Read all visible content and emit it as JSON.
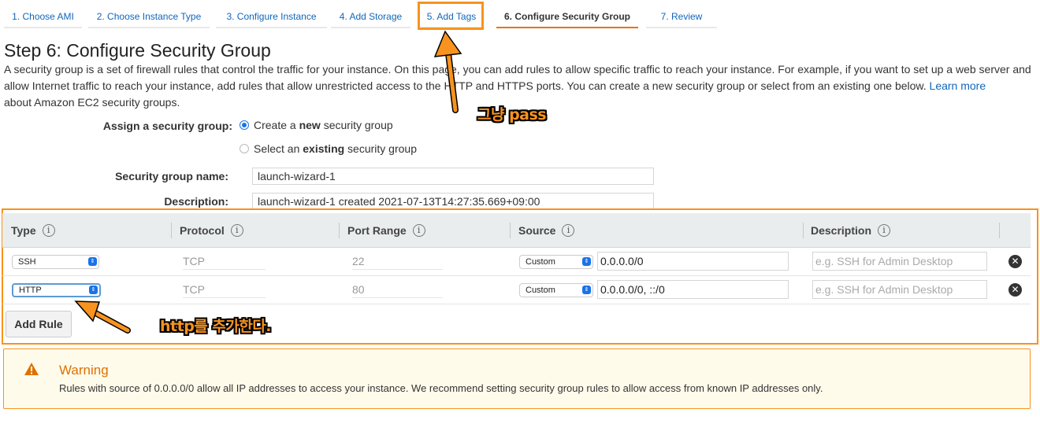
{
  "wizard": {
    "tabs": [
      {
        "label": "1. Choose AMI"
      },
      {
        "label": "2. Choose Instance Type"
      },
      {
        "label": "3. Configure Instance"
      },
      {
        "label": "4. Add Storage"
      },
      {
        "label": "5. Add Tags"
      },
      {
        "label": "6. Configure Security Group"
      },
      {
        "label": "7. Review"
      }
    ],
    "active_tab": "6. Configure Security Group"
  },
  "page": {
    "title": "Step 6: Configure Security Group",
    "intro_text": "A security group is a set of firewall rules that control the traffic for your instance. On this page, you can add rules to allow specific traffic to reach your instance. For example, if you want to set up a web server and allow Internet traffic to reach your instance, add rules that allow unrestricted access to the HTTP and HTTPS ports. You can create a new security group or select from an existing one below.",
    "learn_more_text": "Learn more",
    "intro_tail": "about Amazon EC2 security groups."
  },
  "assign": {
    "label": "Assign a security group:",
    "option_new_prefix": "Create a ",
    "option_new_bold": "new",
    "option_new_suffix": " security group",
    "option_existing_prefix": "Select an ",
    "option_existing_bold": "existing",
    "option_existing_suffix": " security group",
    "selected": "new"
  },
  "group_name": {
    "label": "Security group name:",
    "value": "launch-wizard-1"
  },
  "description": {
    "label": "Description:",
    "value": "launch-wizard-1 created 2021-07-13T14:27:35.669+09:00"
  },
  "rules_table": {
    "columns": [
      "Type",
      "Protocol",
      "Port Range",
      "Source",
      "Description"
    ],
    "info_glyph": "i",
    "rows": [
      {
        "type": "SSH",
        "protocol": "TCP",
        "port_range": "22",
        "source_mode": "Custom",
        "source": "0.0.0.0/0",
        "description_placeholder": "e.g. SSH for Admin Desktop"
      },
      {
        "type": "HTTP",
        "protocol": "TCP",
        "port_range": "80",
        "source_mode": "Custom",
        "source": "0.0.0.0/0, ::/0",
        "description_placeholder": "e.g. SSH for Admin Desktop"
      }
    ],
    "add_rule_label": "Add Rule",
    "remove_glyph": "✕"
  },
  "warning": {
    "title": "Warning",
    "text": "Rules with source of 0.0.0.0/0 allow all IP addresses to access your instance. We recommend setting security group rules to allow access from known IP addresses only."
  },
  "annotations": {
    "tags_note": "그냥 pass",
    "http_note": "http를 추가한다."
  },
  "colors": {
    "accent_orange": "#f7931e",
    "link_blue": "#1166bb",
    "warning_bg": "#fffbeb"
  }
}
